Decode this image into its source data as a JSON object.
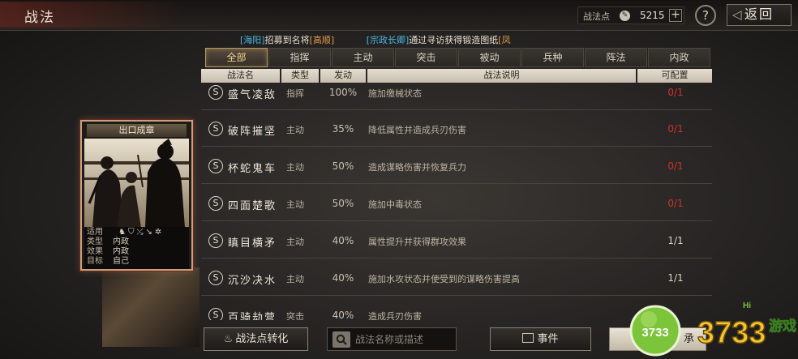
{
  "header": {
    "title": "战法",
    "points_label": "战法点",
    "points_value": "5215",
    "add_label": "+",
    "help_label": "?",
    "back_label": "返回"
  },
  "ticker": {
    "msg1_name": "[海阳]",
    "msg1_text": "招募到名将",
    "msg1_item": "[高顺]",
    "msg2_name": "[宗政长卿]",
    "msg2_text": "通过寻访获得锻造图纸",
    "msg2_item": "[凤"
  },
  "tabs": [
    "全部",
    "指挥",
    "主动",
    "突击",
    "被动",
    "兵种",
    "阵法",
    "内政"
  ],
  "table": {
    "headers": [
      "战法名",
      "类型",
      "发动",
      "战法说明",
      "可配置"
    ],
    "rows": [
      {
        "badge": "S",
        "name": "盛气凌敌",
        "type": "指挥",
        "rate": "100%",
        "desc": "施加缴械状态",
        "cfg": "0/1",
        "cfg_color": "#d0302a"
      },
      {
        "badge": "S",
        "name": "破阵摧坚",
        "type": "主动",
        "rate": "35%",
        "desc": "降低属性并造成兵刃伤害",
        "cfg": "0/1",
        "cfg_color": "#d0302a"
      },
      {
        "badge": "S",
        "name": "杯蛇鬼车",
        "type": "主动",
        "rate": "50%",
        "desc": "造成谋略伤害并恢复兵力",
        "cfg": "0/1",
        "cfg_color": "#d0302a"
      },
      {
        "badge": "S",
        "name": "四面楚歌",
        "type": "主动",
        "rate": "50%",
        "desc": "施加中毒状态",
        "cfg": "0/1",
        "cfg_color": "#d0302a"
      },
      {
        "badge": "S",
        "name": "瞋目横矛",
        "type": "主动",
        "rate": "40%",
        "desc": "属性提升并获得群攻效果",
        "cfg": "1/1",
        "cfg_color": "#d8d0c0"
      },
      {
        "badge": "S",
        "name": "沉沙决水",
        "type": "主动",
        "rate": "40%",
        "desc": "施加水攻状态并使受到的谋略伤害提高",
        "cfg": "1/1",
        "cfg_color": "#d8d0c0"
      },
      {
        "badge": "S",
        "name": "百骑劫营",
        "type": "突击",
        "rate": "40%",
        "desc": "造成兵刃伤害",
        "cfg": "",
        "cfg_color": "#d8d0c0"
      }
    ]
  },
  "card": {
    "title": "出口成章",
    "rows": [
      {
        "key": "适用",
        "value": ""
      },
      {
        "key": "类型",
        "value": "内政"
      },
      {
        "key": "效果",
        "value": "内政"
      },
      {
        "key": "目标",
        "value": "自己"
      }
    ],
    "troop_icons": [
      "cavalry-icon",
      "shield-icon",
      "bow-icon",
      "spear-icon",
      "wheel-icon"
    ]
  },
  "bottom": {
    "convert_label": "战法点转化",
    "search_placeholder": "战法名称或描述",
    "event_label": "事件",
    "other_label": "承"
  },
  "watermark": {
    "brand": "3733",
    "tag": "游戏",
    "hi": "Hi"
  }
}
